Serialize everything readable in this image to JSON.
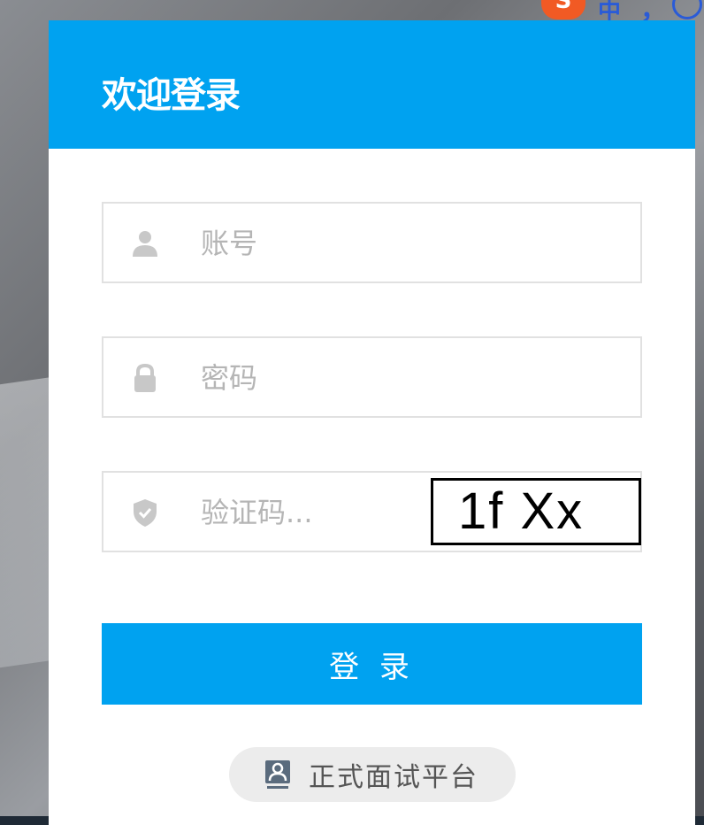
{
  "header": {
    "title": "欢迎登录"
  },
  "form": {
    "account": {
      "placeholder": "账号",
      "icon": "user-icon"
    },
    "password": {
      "placeholder": "密码",
      "icon": "lock-icon"
    },
    "captcha": {
      "placeholder": "验证码...",
      "icon": "shield-icon",
      "image_text": "1f Xx"
    }
  },
  "login_button": {
    "label": "登 录"
  },
  "platform_link": {
    "label": "正式面试平台",
    "icon": "id-card-icon"
  },
  "ime": {
    "logo": "S",
    "mode": "中",
    "punct": "，"
  },
  "colors": {
    "accent": "#00a2f0",
    "placeholder": "#b5b5b5",
    "border": "#e1e1e1"
  }
}
